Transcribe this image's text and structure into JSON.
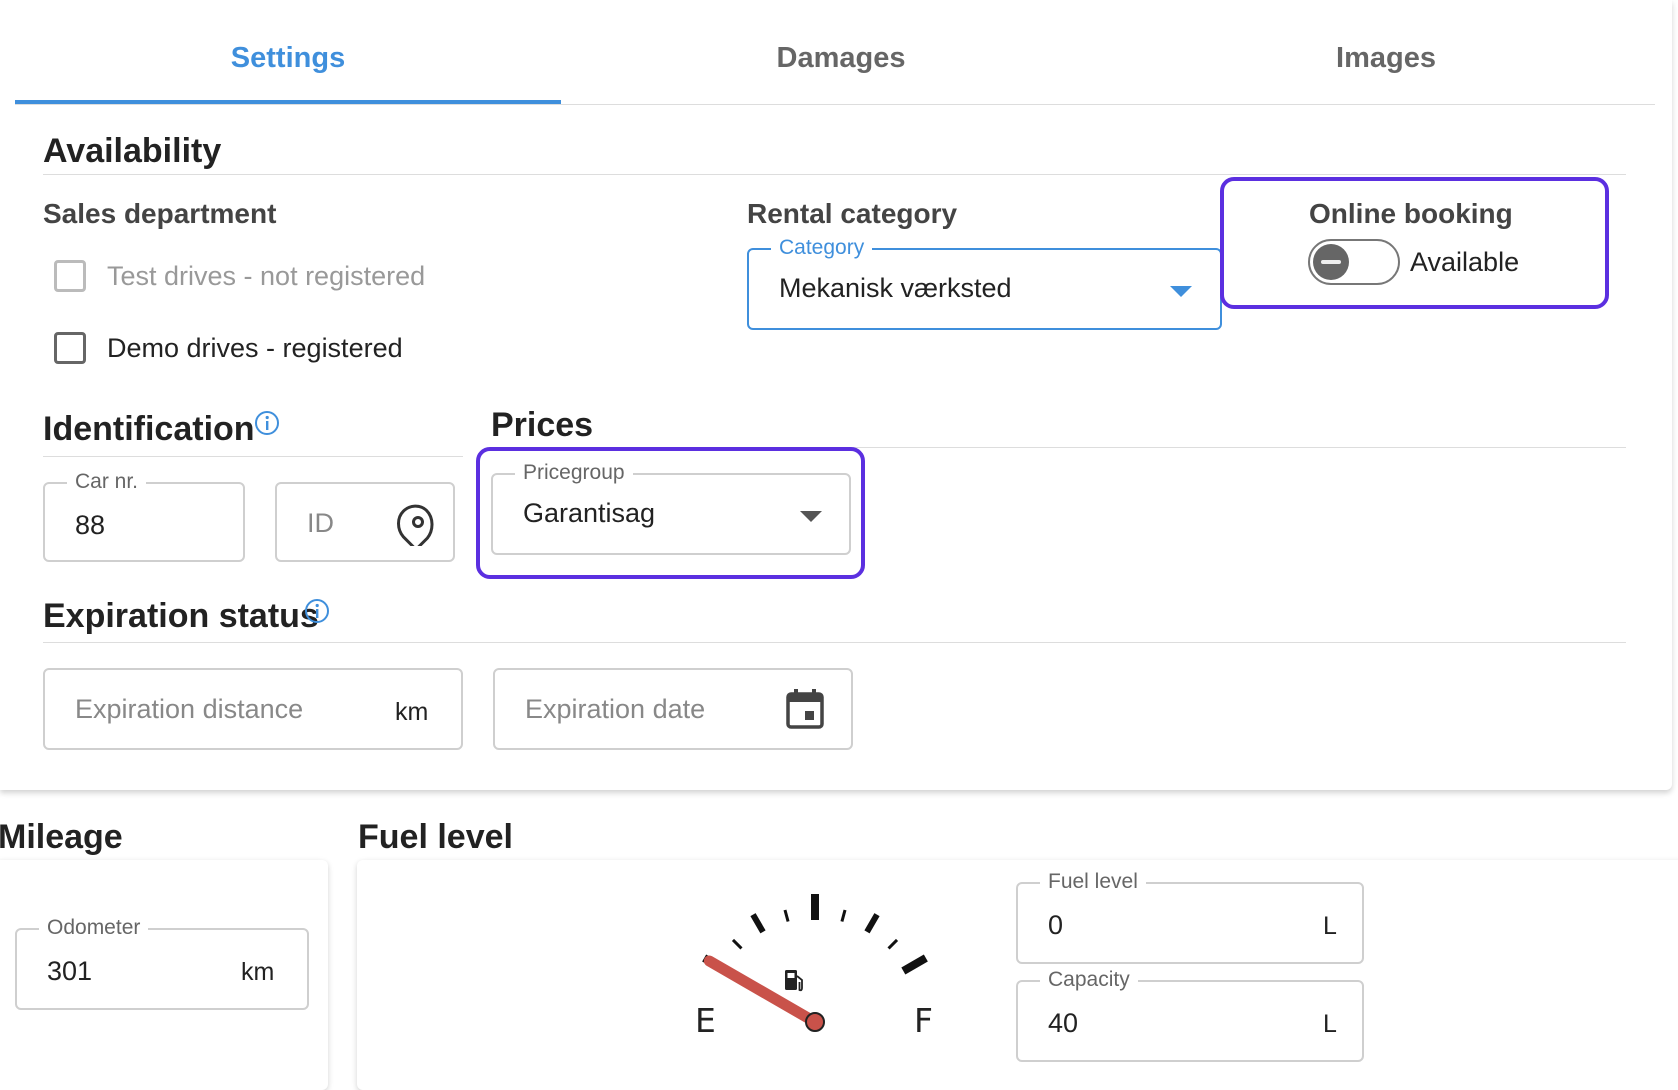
{
  "tabs": [
    {
      "label": "Settings",
      "active": true
    },
    {
      "label": "Damages",
      "active": false
    },
    {
      "label": "Images",
      "active": false
    }
  ],
  "availability": {
    "title": "Availability",
    "sales_department": {
      "label": "Sales department",
      "options": [
        {
          "label": "Test drives - not registered",
          "disabled": true,
          "checked": false
        },
        {
          "label": "Demo drives - registered",
          "disabled": false,
          "checked": false
        }
      ]
    },
    "rental_category": {
      "label": "Rental category",
      "field_label": "Category",
      "value": "Mekanisk værksted"
    },
    "online_booking": {
      "label": "Online booking",
      "toggle_label": "Available",
      "toggle_on": false
    }
  },
  "identification": {
    "title": "Identification",
    "car_nr": {
      "label": "Car nr.",
      "value": "88"
    },
    "id": {
      "placeholder": "ID"
    }
  },
  "prices": {
    "title": "Prices",
    "pricegroup": {
      "label": "Pricegroup",
      "value": "Garantisag"
    }
  },
  "expiration": {
    "title": "Expiration status",
    "distance": {
      "placeholder": "Expiration distance",
      "unit": "km"
    },
    "date": {
      "placeholder": "Expiration date"
    }
  },
  "mileage": {
    "title": "Mileage",
    "odometer": {
      "label": "Odometer",
      "value": "301",
      "unit": "km"
    }
  },
  "fuel": {
    "title": "Fuel level",
    "gauge": {
      "empty_label": "E",
      "full_label": "F",
      "level_fraction": 0
    },
    "fuel_level": {
      "label": "Fuel level",
      "value": "0",
      "unit": "L"
    },
    "capacity": {
      "label": "Capacity",
      "value": "40",
      "unit": "L"
    }
  },
  "colors": {
    "accent": "#3f8fdc",
    "highlight": "#5b2fe0",
    "needle": "#c9524a"
  },
  "icons": [
    "info-icon",
    "tag-icon",
    "calendar-icon",
    "fuel-pump-icon",
    "chevron-down-icon"
  ]
}
